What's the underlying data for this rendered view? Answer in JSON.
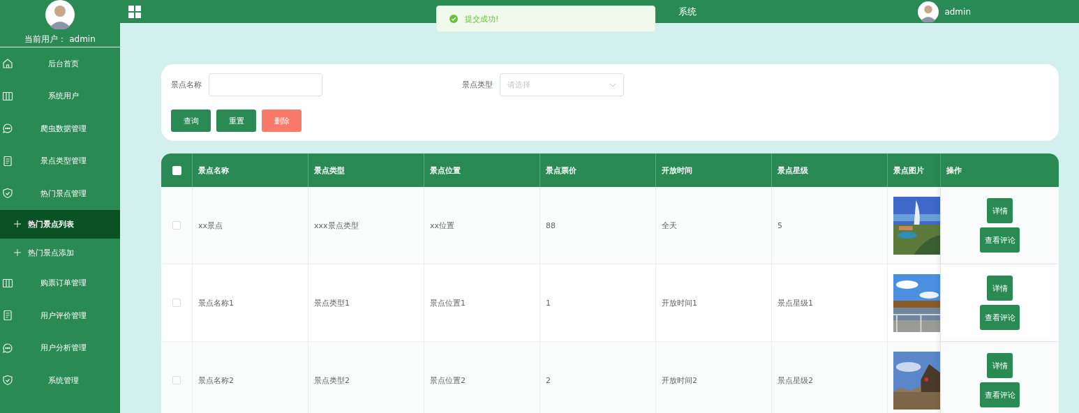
{
  "sidebar": {
    "user_label": "当前用户：",
    "user_name": "admin",
    "items": [
      {
        "kind": "menu",
        "label": "后台首页",
        "selected": false
      },
      {
        "kind": "menu",
        "label": "系统用户",
        "selected": false
      },
      {
        "kind": "menu",
        "label": "爬虫数据管理",
        "selected": false
      },
      {
        "kind": "menu",
        "label": "景点类型管理",
        "selected": false
      },
      {
        "kind": "menu",
        "label": "热门景点管理",
        "selected": false
      },
      {
        "kind": "sub",
        "label": "热门景点列表",
        "selected": true
      },
      {
        "kind": "sub",
        "label": "热门景点添加",
        "selected": false
      },
      {
        "kind": "menu",
        "label": "购票订单管理",
        "selected": false
      },
      {
        "kind": "menu",
        "label": "用户评价管理",
        "selected": false
      },
      {
        "kind": "menu",
        "label": "用户分析管理",
        "selected": false
      },
      {
        "kind": "menu",
        "label": "系统管理",
        "selected": false
      }
    ]
  },
  "header": {
    "title_visible": "系统",
    "user": "admin"
  },
  "toast": {
    "message": "提交成功!"
  },
  "search": {
    "fields": [
      {
        "kind": "input",
        "label": "景点名称"
      },
      {
        "kind": "select",
        "label": "景点类型",
        "placeholder": "请选择"
      }
    ],
    "buttons": [
      {
        "label": "查询",
        "kind": "primary"
      },
      {
        "label": "重置",
        "kind": "primary"
      },
      {
        "label": "删除",
        "kind": "danger"
      }
    ]
  },
  "table": {
    "all_checked": false,
    "columns": [
      "景点名称",
      "景点类型",
      "景点位置",
      "景点票价",
      "开放时间",
      "景点星级",
      "景点图片",
      "操作"
    ],
    "rows": [
      {
        "checked": false,
        "cells": [
          "xx景点",
          "xxx景点类型",
          "xx位置",
          "88",
          "全天",
          "5"
        ],
        "image": {
          "kind": "picture"
        },
        "actions": [
          "详情",
          "查看评论"
        ]
      },
      {
        "checked": false,
        "cells": [
          "景点名称1",
          "景点类型1",
          "景点位置1",
          "1",
          "开放时间1",
          "景点星级1"
        ],
        "image": {
          "kind": "picture"
        },
        "actions": [
          "详情",
          "查看评论"
        ]
      },
      {
        "checked": false,
        "cells": [
          "景点名称2",
          "景点类型2",
          "景点位置2",
          "2",
          "开放时间2",
          "景点星级2"
        ],
        "image": {
          "kind": "picture"
        },
        "actions": [
          "详情",
          "查看评论"
        ]
      }
    ]
  }
}
